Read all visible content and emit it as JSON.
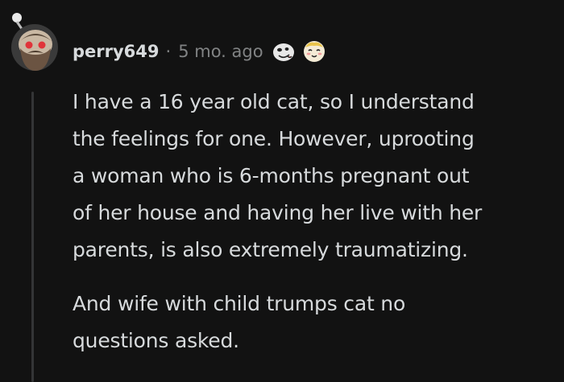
{
  "comment": {
    "username": "perry649",
    "separator": "·",
    "timestamp": "5 mo. ago",
    "avatar_icon": "snoo-bearded-avatar-icon",
    "awards": [
      "silly-face-award-icon",
      "blushing-face-award-icon"
    ],
    "paragraphs": [
      {
        "lines": [
          "I have a 16 year old cat, so I understand",
          "the feelings for one. However, uprooting",
          "a woman who is 6-months pregnant out",
          "of her house and having her live with her",
          "parents, is also extremely traumatizing."
        ]
      },
      {
        "lines": [
          "And wife with child trumps cat no",
          "questions asked."
        ]
      }
    ]
  },
  "colors": {
    "background": "#121212",
    "text": "#d7dadc",
    "meta": "#818384",
    "thread_line": "#343536",
    "avatar_eye": "#e0343a"
  }
}
